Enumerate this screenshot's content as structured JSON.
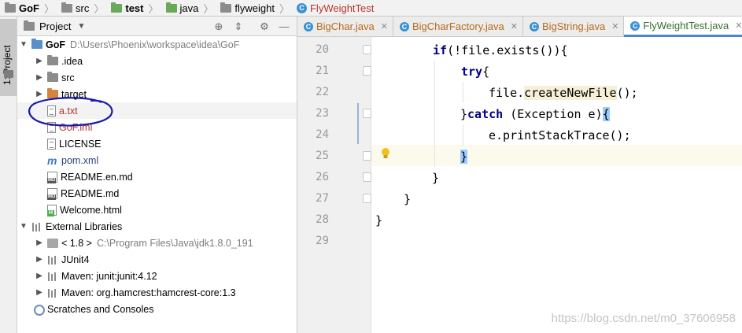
{
  "breadcrumb": [
    {
      "label": "GoF",
      "icon": "folder-icon",
      "bold": true
    },
    {
      "label": "src",
      "icon": "folder-icon",
      "bold": false
    },
    {
      "label": "test",
      "icon": "folder-icon",
      "bold": true
    },
    {
      "label": "java",
      "icon": "folder-icon",
      "bold": false
    },
    {
      "label": "flyweight",
      "icon": "package-icon",
      "bold": false
    },
    {
      "label": "FlyWeightTest",
      "icon": "class-icon",
      "bold": false
    }
  ],
  "stripe": {
    "label": "1: Project"
  },
  "project_panel": {
    "title": "Project",
    "tree": [
      {
        "label": "GoF",
        "hint": "D:\\Users\\Phoenix\\workspace\\idea\\GoF",
        "icon": "module-folder-icon",
        "expanded": true
      },
      {
        "label": ".idea",
        "icon": "folder-icon"
      },
      {
        "label": "src",
        "icon": "folder-icon"
      },
      {
        "label": "target",
        "icon": "excluded-folder-icon"
      },
      {
        "label": "a.txt",
        "icon": "text-file-icon"
      },
      {
        "label": "GoF.iml",
        "icon": "iml-file-icon"
      },
      {
        "label": "LICENSE",
        "icon": "file-icon"
      },
      {
        "label": "pom.xml",
        "icon": "maven-icon"
      },
      {
        "label": "README.en.md",
        "icon": "markdown-icon"
      },
      {
        "label": "README.md",
        "icon": "markdown-icon"
      },
      {
        "label": "Welcome.html",
        "icon": "html-icon"
      },
      {
        "label": "External Libraries",
        "icon": "library-icon",
        "expanded": true
      },
      {
        "label": "< 1.8 >",
        "hint": "C:\\Program Files\\Java\\jdk1.8.0_191",
        "icon": "jdk-icon"
      },
      {
        "label": "JUnit4",
        "icon": "library-icon"
      },
      {
        "label": "Maven: junit:junit:4.12",
        "icon": "library-icon"
      },
      {
        "label": "Maven: org.hamcrest:hamcrest-core:1.3",
        "icon": "library-icon"
      },
      {
        "label": "Scratches and Consoles",
        "icon": "scratches-icon"
      }
    ]
  },
  "tabs": [
    {
      "label": "BigChar.java",
      "active": false,
      "color": "#b76a1c"
    },
    {
      "label": "BigCharFactory.java",
      "active": false,
      "color": "#b76a1c"
    },
    {
      "label": "BigString.java",
      "active": false,
      "color": "#b76a1c"
    },
    {
      "label": "FlyWeightTest.java",
      "active": true,
      "color": "#356f2f"
    }
  ],
  "editor": {
    "line_numbers": [
      "20",
      "21",
      "22",
      "23",
      "24",
      "25",
      "26",
      "27",
      "28",
      "29"
    ],
    "current_line": "25",
    "code": {
      "l20_kw": "if",
      "l20_rest": "(!file.exists()){",
      "l21_kw": "try",
      "l21_rest": "{",
      "l22_pre": "file.",
      "l22_method": "createNewFile",
      "l22_post": "();",
      "l23_open": "}",
      "l23_kw": "catch",
      "l23_mid": " (Exception e)",
      "l23_brace": "{",
      "l24": "e.printStackTrace();",
      "l25": "}",
      "l26": "}",
      "l27": "}",
      "l28": "}"
    }
  },
  "watermark": "https://blog.csdn.net/m0_37606958",
  "colors": {
    "keyword": "#000080",
    "bracket_highlight": "#99ccff",
    "annotation": "#1a1aa8"
  }
}
